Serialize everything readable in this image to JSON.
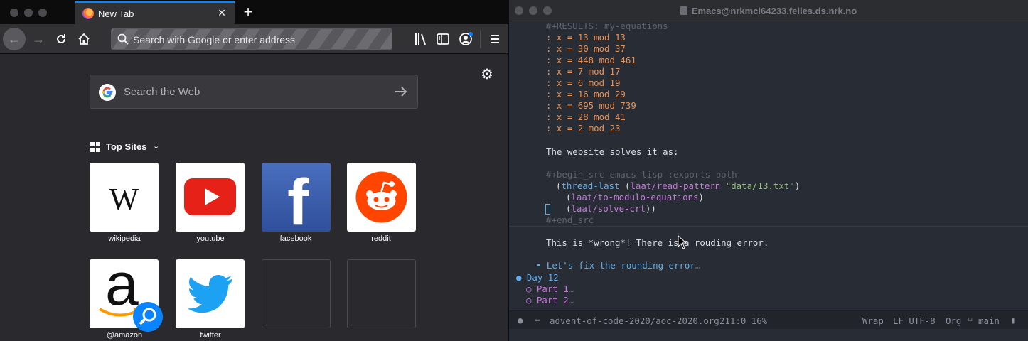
{
  "firefox": {
    "tab": {
      "title": "New Tab"
    },
    "url_placeholder": "Search with Google or enter address",
    "web_search_placeholder": "Search the Web",
    "top_sites_label": "Top Sites",
    "top_sites": [
      {
        "label": "wikipedia"
      },
      {
        "label": "youtube"
      },
      {
        "label": "facebook"
      },
      {
        "label": "reddit"
      },
      {
        "label": "@amazon"
      },
      {
        "label": "twitter"
      }
    ],
    "colors": {
      "accent": "#0a84ff",
      "background": "#2a2a2e",
      "toolbar": "#323234"
    }
  },
  "emacs": {
    "title": "Emacs@nrkmci64233.felles.ds.nrk.no",
    "lines": {
      "results": "#+RESULTS: my-equations",
      "r1": ": x = 13 mod 13",
      "r2": ": x = 30 mod 37",
      "r3": ": x = 448 mod 461",
      "r4": ": x = 7 mod 17",
      "r5": ": x = 6 mod 19",
      "r6": ": x = 16 mod 29",
      "r7": ": x = 695 mod 739",
      "r8": ": x = 28 mod 41",
      "r9": ": x = 2 mod 23",
      "website": "The website solves it as:",
      "begin_src": "#+begin_src emacs-lisp :exports both",
      "c1_open": "(",
      "c1_fn": "thread-last",
      "c1_mid": " (",
      "c1_fn2": "laat/read-pattern",
      "c1_sp": " ",
      "c1_str": "\"data/13.txt\"",
      "c1_close": ")",
      "c2_open": "(",
      "c2_fn": "laat/to-modulo-equations",
      "c2_close": ")",
      "c3_open": "(",
      "c3_fn": "laat/solve-crt",
      "c3_close": "))",
      "end_src": "#+end_src",
      "wrong": "This is *wrong*! There is a rouding error.",
      "bullet": "• Let's fix the rounding error",
      "ellipsis": "…",
      "day12": "● Day 12",
      "part1": "○ Part 1",
      "part2": "○ Part 2"
    },
    "modeline": {
      "file": "advent-of-code-2020/aoc-2020.org",
      "position": "211:0 16%",
      "wrap": "Wrap",
      "encoding": "LF UTF-8",
      "mode": "Org",
      "branch": "main"
    },
    "colors": {
      "background": "#282c34",
      "result": "#e5925a",
      "keyword": "#61afef",
      "heading2": "#c678dd",
      "string": "#98c379"
    }
  }
}
